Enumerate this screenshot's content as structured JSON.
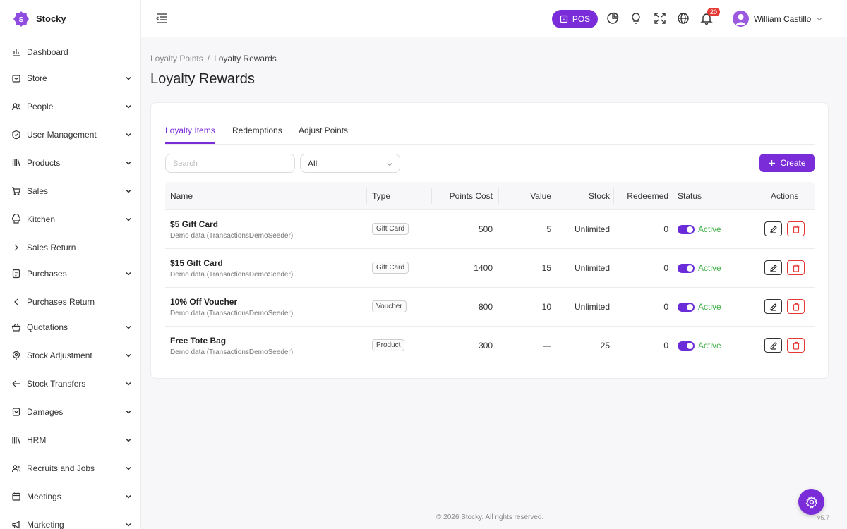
{
  "app": {
    "name": "Stocky",
    "accent": "#7b2cd9"
  },
  "sidebar": {
    "items": [
      {
        "label": "Dashboard",
        "icon": "chart-bar-icon",
        "chevron": "none"
      },
      {
        "label": "Store",
        "icon": "store-icon",
        "chevron": "down"
      },
      {
        "label": "People",
        "icon": "users-icon",
        "chevron": "down"
      },
      {
        "label": "User Management",
        "icon": "shield-icon",
        "chevron": "down"
      },
      {
        "label": "Products",
        "icon": "books-icon",
        "chevron": "down"
      },
      {
        "label": "Sales",
        "icon": "cart-icon",
        "chevron": "down"
      },
      {
        "label": "Kitchen",
        "icon": "chef-hat-icon",
        "chevron": "down"
      },
      {
        "label": "Sales Return",
        "icon": "chevron-right-icon",
        "chevron": "none"
      },
      {
        "label": "Purchases",
        "icon": "receipt-icon",
        "chevron": "down"
      },
      {
        "label": "Purchases Return",
        "icon": "chevron-left-icon",
        "chevron": "none"
      },
      {
        "label": "Quotations",
        "icon": "basket-icon",
        "chevron": "down"
      },
      {
        "label": "Stock Adjustment",
        "icon": "location-icon",
        "chevron": "down"
      },
      {
        "label": "Stock Transfers",
        "icon": "arrow-left-icon",
        "chevron": "down"
      },
      {
        "label": "Damages",
        "icon": "box-icon",
        "chevron": "down"
      },
      {
        "label": "HRM",
        "icon": "library-icon",
        "chevron": "down"
      },
      {
        "label": "Recruits and Jobs",
        "icon": "users-icon",
        "chevron": "down"
      },
      {
        "label": "Meetings",
        "icon": "calendar-icon",
        "chevron": "down"
      },
      {
        "label": "Marketing",
        "icon": "megaphone-icon",
        "chevron": "down"
      }
    ]
  },
  "header": {
    "pos_label": "POS",
    "notification_count": "20",
    "user_name": "William Castillo"
  },
  "breadcrumb": {
    "parent": "Loyalty Points",
    "separator": "/",
    "current": "Loyalty Rewards"
  },
  "page": {
    "title": "Loyalty Rewards"
  },
  "tabs": [
    {
      "label": "Loyalty Items",
      "active": true
    },
    {
      "label": "Redemptions",
      "active": false
    },
    {
      "label": "Adjust Points",
      "active": false
    }
  ],
  "filters": {
    "search_placeholder": "Search",
    "select_value": "All",
    "create_label": "Create"
  },
  "table": {
    "headers": {
      "name": "Name",
      "type": "Type",
      "points_cost": "Points Cost",
      "value": "Value",
      "stock": "Stock",
      "redeemed": "Redeemed",
      "status": "Status",
      "actions": "Actions"
    },
    "rows": [
      {
        "name": "$5 Gift Card",
        "sub": "Demo data (TransactionsDemoSeeder)",
        "type": "Gift Card",
        "points_cost": "500",
        "value": "5",
        "stock": "Unlimited",
        "redeemed": "0",
        "status": "Active"
      },
      {
        "name": "$15 Gift Card",
        "sub": "Demo data (TransactionsDemoSeeder)",
        "type": "Gift Card",
        "points_cost": "1400",
        "value": "15",
        "stock": "Unlimited",
        "redeemed": "0",
        "status": "Active"
      },
      {
        "name": "10% Off Voucher",
        "sub": "Demo data (TransactionsDemoSeeder)",
        "type": "Voucher",
        "points_cost": "800",
        "value": "10",
        "stock": "Unlimited",
        "redeemed": "0",
        "status": "Active"
      },
      {
        "name": "Free Tote Bag",
        "sub": "Demo data (TransactionsDemoSeeder)",
        "type": "Product",
        "points_cost": "300",
        "value": "—",
        "stock": "25",
        "redeemed": "0",
        "status": "Active"
      }
    ]
  },
  "footer": {
    "copyright": "© 2026 Stocky. All rights reserved.",
    "version": "v5.7"
  }
}
